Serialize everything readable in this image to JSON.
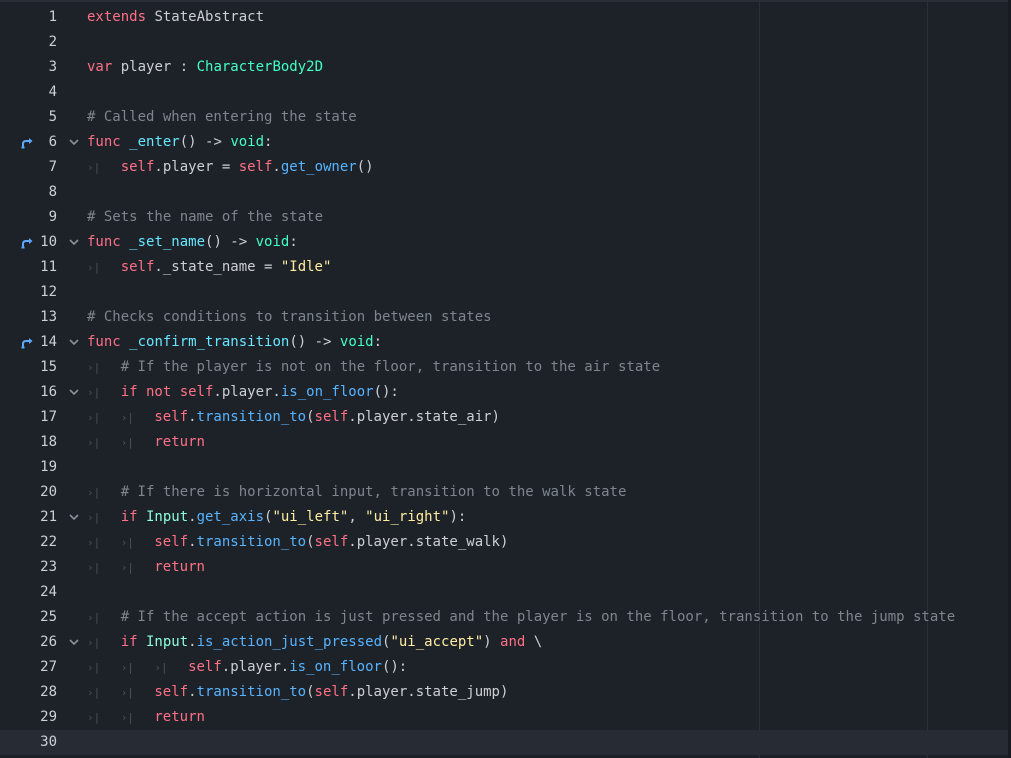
{
  "editor": {
    "lines": [
      {
        "n": "1",
        "indent": 0,
        "fold": false,
        "override": false,
        "current": false,
        "tokens": [
          [
            "kw",
            "extends"
          ],
          [
            "tx",
            " StateAbstract"
          ]
        ]
      },
      {
        "n": "2",
        "indent": 0,
        "fold": false,
        "override": false,
        "current": false,
        "tokens": []
      },
      {
        "n": "3",
        "indent": 0,
        "fold": false,
        "override": false,
        "current": false,
        "tokens": [
          [
            "kw",
            "var"
          ],
          [
            "tx",
            " player : "
          ],
          [
            "ty",
            "CharacterBody2D"
          ]
        ]
      },
      {
        "n": "4",
        "indent": 0,
        "fold": false,
        "override": false,
        "current": false,
        "tokens": []
      },
      {
        "n": "5",
        "indent": 0,
        "fold": false,
        "override": false,
        "current": false,
        "tokens": [
          [
            "cm",
            "# Called when entering the state"
          ]
        ]
      },
      {
        "n": "6",
        "indent": 0,
        "fold": true,
        "override": true,
        "current": false,
        "tokens": [
          [
            "kw",
            "func"
          ],
          [
            "tx",
            " "
          ],
          [
            "fnd",
            "_enter"
          ],
          [
            "tx",
            "() -> "
          ],
          [
            "ty",
            "void"
          ],
          [
            "tx",
            ":"
          ]
        ]
      },
      {
        "n": "7",
        "indent": 1,
        "fold": false,
        "override": false,
        "current": false,
        "tokens": [
          [
            "sf",
            "self"
          ],
          [
            "tx",
            ".player = "
          ],
          [
            "sf",
            "self"
          ],
          [
            "tx",
            "."
          ],
          [
            "fn",
            "get_owner"
          ],
          [
            "tx",
            "()"
          ]
        ]
      },
      {
        "n": "8",
        "indent": 0,
        "fold": false,
        "override": false,
        "current": false,
        "tokens": []
      },
      {
        "n": "9",
        "indent": 0,
        "fold": false,
        "override": false,
        "current": false,
        "tokens": [
          [
            "cm",
            "# Sets the name of the state"
          ]
        ]
      },
      {
        "n": "10",
        "indent": 0,
        "fold": true,
        "override": true,
        "current": false,
        "tokens": [
          [
            "kw",
            "func"
          ],
          [
            "tx",
            " "
          ],
          [
            "fnd",
            "_set_name"
          ],
          [
            "tx",
            "() -> "
          ],
          [
            "ty",
            "void"
          ],
          [
            "tx",
            ":"
          ]
        ]
      },
      {
        "n": "11",
        "indent": 1,
        "fold": false,
        "override": false,
        "current": false,
        "tokens": [
          [
            "sf",
            "self"
          ],
          [
            "tx",
            "._state_name = "
          ],
          [
            "st",
            "\"Idle\""
          ]
        ]
      },
      {
        "n": "12",
        "indent": 0,
        "fold": false,
        "override": false,
        "current": false,
        "tokens": []
      },
      {
        "n": "13",
        "indent": 0,
        "fold": false,
        "override": false,
        "current": false,
        "tokens": [
          [
            "cm",
            "# Checks conditions to transition between states"
          ]
        ]
      },
      {
        "n": "14",
        "indent": 0,
        "fold": true,
        "override": true,
        "current": false,
        "tokens": [
          [
            "kw",
            "func"
          ],
          [
            "tx",
            " "
          ],
          [
            "fnd",
            "_confirm_transition"
          ],
          [
            "tx",
            "() -> "
          ],
          [
            "ty",
            "void"
          ],
          [
            "tx",
            ":"
          ]
        ]
      },
      {
        "n": "15",
        "indent": 1,
        "fold": false,
        "override": false,
        "current": false,
        "tokens": [
          [
            "cm",
            "# If the player is not on the floor, transition to the air state"
          ]
        ]
      },
      {
        "n": "16",
        "indent": 1,
        "fold": true,
        "override": false,
        "current": false,
        "tokens": [
          [
            "kw",
            "if not "
          ],
          [
            "sf",
            "self"
          ],
          [
            "tx",
            ".player."
          ],
          [
            "fn",
            "is_on_floor"
          ],
          [
            "tx",
            "():"
          ]
        ]
      },
      {
        "n": "17",
        "indent": 2,
        "fold": false,
        "override": false,
        "current": false,
        "tokens": [
          [
            "sf",
            "self"
          ],
          [
            "tx",
            "."
          ],
          [
            "fn",
            "transition_to"
          ],
          [
            "tx",
            "("
          ],
          [
            "sf",
            "self"
          ],
          [
            "tx",
            ".player.state_air)"
          ]
        ]
      },
      {
        "n": "18",
        "indent": 2,
        "fold": false,
        "override": false,
        "current": false,
        "tokens": [
          [
            "kw",
            "return"
          ]
        ]
      },
      {
        "n": "19",
        "indent": 0,
        "fold": false,
        "override": false,
        "current": false,
        "tokens": []
      },
      {
        "n": "20",
        "indent": 1,
        "fold": false,
        "override": false,
        "current": false,
        "tokens": [
          [
            "cm",
            "# If there is horizontal input, transition to the walk state"
          ]
        ]
      },
      {
        "n": "21",
        "indent": 1,
        "fold": true,
        "override": false,
        "current": false,
        "tokens": [
          [
            "kw",
            "if "
          ],
          [
            "ty2",
            "Input"
          ],
          [
            "tx",
            "."
          ],
          [
            "fn",
            "get_axis"
          ],
          [
            "tx",
            "("
          ],
          [
            "st",
            "\"ui_left\""
          ],
          [
            "tx",
            ", "
          ],
          [
            "st",
            "\"ui_right\""
          ],
          [
            "tx",
            "):"
          ]
        ]
      },
      {
        "n": "22",
        "indent": 2,
        "fold": false,
        "override": false,
        "current": false,
        "tokens": [
          [
            "sf",
            "self"
          ],
          [
            "tx",
            "."
          ],
          [
            "fn",
            "transition_to"
          ],
          [
            "tx",
            "("
          ],
          [
            "sf",
            "self"
          ],
          [
            "tx",
            ".player.state_walk)"
          ]
        ]
      },
      {
        "n": "23",
        "indent": 2,
        "fold": false,
        "override": false,
        "current": false,
        "tokens": [
          [
            "kw",
            "return"
          ]
        ]
      },
      {
        "n": "24",
        "indent": 0,
        "fold": false,
        "override": false,
        "current": false,
        "tokens": []
      },
      {
        "n": "25",
        "indent": 1,
        "fold": false,
        "override": false,
        "current": false,
        "tokens": [
          [
            "cm",
            "# If the accept action is just pressed and the player is on the floor, transition to the jump state"
          ]
        ]
      },
      {
        "n": "26",
        "indent": 1,
        "fold": true,
        "override": false,
        "current": false,
        "tokens": [
          [
            "kw",
            "if "
          ],
          [
            "ty2",
            "Input"
          ],
          [
            "tx",
            "."
          ],
          [
            "fn",
            "is_action_just_pressed"
          ],
          [
            "tx",
            "("
          ],
          [
            "st",
            "\"ui_accept\""
          ],
          [
            "tx",
            ") "
          ],
          [
            "kw",
            "and"
          ],
          [
            "tx",
            " \\"
          ]
        ]
      },
      {
        "n": "27",
        "indent": 3,
        "fold": false,
        "override": false,
        "current": false,
        "tokens": [
          [
            "sf",
            "self"
          ],
          [
            "tx",
            ".player."
          ],
          [
            "fn",
            "is_on_floor"
          ],
          [
            "tx",
            "():"
          ]
        ]
      },
      {
        "n": "28",
        "indent": 2,
        "fold": false,
        "override": false,
        "current": false,
        "tokens": [
          [
            "sf",
            "self"
          ],
          [
            "tx",
            "."
          ],
          [
            "fn",
            "transition_to"
          ],
          [
            "tx",
            "("
          ],
          [
            "sf",
            "self"
          ],
          [
            "tx",
            ".player.state_jump)"
          ]
        ]
      },
      {
        "n": "29",
        "indent": 2,
        "fold": false,
        "override": false,
        "current": false,
        "tokens": [
          [
            "kw",
            "return"
          ]
        ]
      },
      {
        "n": "30",
        "indent": 0,
        "fold": false,
        "override": false,
        "current": true,
        "tokens": []
      }
    ]
  },
  "icons": {
    "tab": "tab-indent-icon",
    "fold": "chevron-down-icon",
    "override": "method-override-icon"
  },
  "colors": {
    "background": "#1d2229",
    "current_line": "#272c34",
    "keyword": "#ff7085",
    "type": "#42ffc2",
    "function": "#57b3ff",
    "string": "#ffeda1",
    "comment": "#7f858d",
    "override_icon": "#5ca8ff"
  }
}
